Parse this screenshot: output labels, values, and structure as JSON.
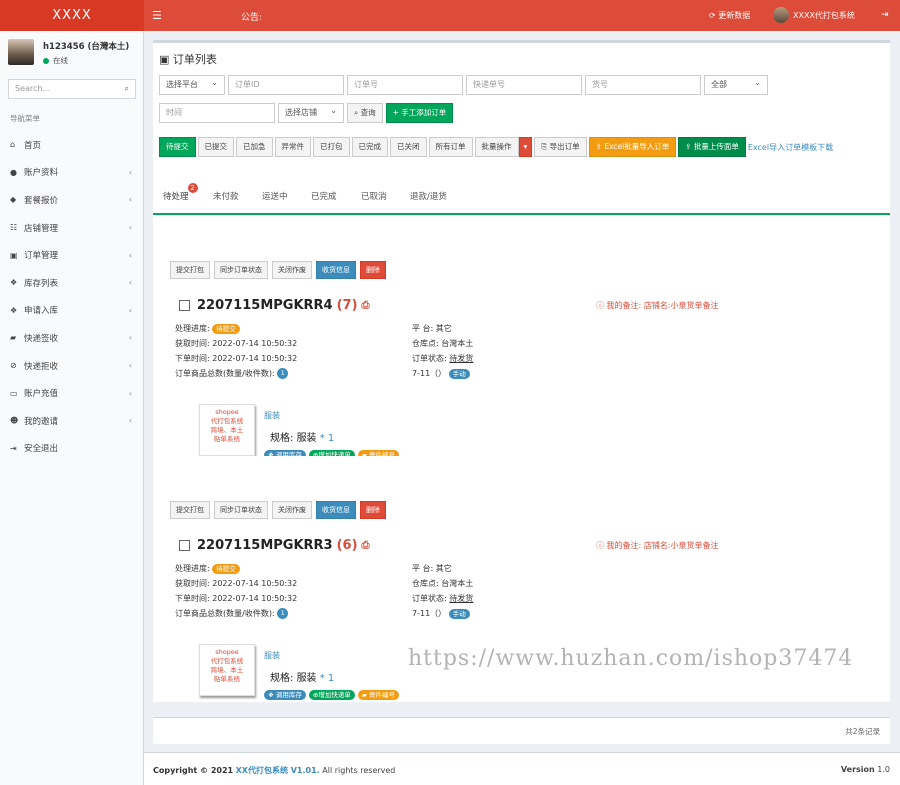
{
  "header": {
    "logo": "XXXX",
    "menu_icon": "bars-icon",
    "notice_label": "公告:",
    "refresh_label": "更新数据",
    "user_label": "XXXX代打包系统"
  },
  "sidebar": {
    "username": "h123456 (台灣本土)",
    "status": "在线",
    "search_placeholder": "Search...",
    "nav_header": "导航菜单",
    "items": [
      {
        "icon": "home-icon",
        "label": "首页",
        "arrow": ""
      },
      {
        "icon": "user-icon",
        "label": "账户资料",
        "arrow": "‹"
      },
      {
        "icon": "tag-icon",
        "label": "套餐报价",
        "arrow": "‹"
      },
      {
        "icon": "list-icon",
        "label": "店铺管理",
        "arrow": "‹"
      },
      {
        "icon": "cart-icon",
        "label": "订单管理",
        "arrow": "‹"
      },
      {
        "icon": "cubes-icon",
        "label": "库存列表",
        "arrow": "‹"
      },
      {
        "icon": "cubes-icon",
        "label": "申请入库",
        "arrow": "‹"
      },
      {
        "icon": "truck-icon",
        "label": "快递签收",
        "arrow": "‹"
      },
      {
        "icon": "ban-icon",
        "label": "快递拒收",
        "arrow": "‹"
      },
      {
        "icon": "credit-card-icon",
        "label": "账户充值",
        "arrow": "‹"
      },
      {
        "icon": "users-icon",
        "label": "我的邀请",
        "arrow": "‹"
      },
      {
        "icon": "sign-out-icon",
        "label": "安全退出",
        "arrow": ""
      }
    ]
  },
  "orders_panel": {
    "title": "订单列表",
    "filters_row1": {
      "platform": "选择平台",
      "order_id": "订单ID",
      "order_no": "订单号",
      "express_no": "快递单号",
      "goods_no": "货号",
      "all": "全部"
    },
    "filters_row2": {
      "time": "时间",
      "shop": "选择店铺",
      "query": "查询",
      "add_manual": "手工添加订单"
    },
    "actions": [
      "待提交",
      "已提交",
      "已加急",
      "异常件",
      "已打包",
      "已完成",
      "已关闭",
      "所有订单",
      "批量操作"
    ],
    "export": "导出订单",
    "excel_import": "Excel批量导入订单",
    "batch_upload": "批量上传面单",
    "template_link": "Excel导入订单模板下载"
  },
  "tabs": [
    {
      "label": "待处理",
      "badge": "2"
    },
    {
      "label": "未付款"
    },
    {
      "label": "运送中"
    },
    {
      "label": "已完成"
    },
    {
      "label": "已取消"
    },
    {
      "label": "退款/退货"
    }
  ],
  "order_buttons": {
    "submit_pack": "提交打包",
    "sync_status": "同步订单状态",
    "close_op": "关闭作废",
    "receiver_info": "收货信息",
    "delete": "删除"
  },
  "order_labels": {
    "progress": "处理进度:",
    "fetch_time": "获取时间:",
    "order_time": "下单时间:",
    "total_goods": "订单商品总数(数量/收件数):",
    "platform": "平 台:",
    "warehouse": "仓库点:",
    "order_status": "订单状态:",
    "manual": "手动",
    "remark_prefix": "我的备注:",
    "shop_prefix": "店铺名:",
    "pill_stock": "调用库存",
    "pill_express": "增加快递单",
    "pill_sender": "寄件编号",
    "spec_prefix": "规格:",
    "thumb_lines": [
      "shopee",
      "代打包系统",
      "跨境、本土",
      "贴单系统"
    ]
  },
  "orders": [
    {
      "number": "2207115MPGKRR4",
      "count": "(7)",
      "progress": "待提交",
      "fetch_time": "2022-07-14 10:50:32",
      "order_time": "2022-07-14 10:50:32",
      "total": "1",
      "platform": "其它",
      "warehouse": "台灣本土",
      "status": "待发货",
      "store": "7-11（）",
      "shop_name": "小泉货单备注",
      "product": "服装",
      "spec": "服装",
      "qty": "* 1"
    },
    {
      "number": "2207115MPGKRR3",
      "count": "(6)",
      "progress": "待提交",
      "fetch_time": "2022-07-14 10:50:32",
      "order_time": "2022-07-14 10:50:32",
      "total": "1",
      "platform": "其它",
      "warehouse": "台灣本土",
      "status": "待发货",
      "store": "7-11（）",
      "shop_name": "小泉货单备注",
      "product": "服装",
      "spec": "服装",
      "qty": "* 1"
    }
  ],
  "pagination": {
    "total_records": "共2条记录"
  },
  "footer": {
    "copyright": "Copyright © 2021",
    "brand": "XX代打包系统 V1.01.",
    "rights": "All rights reserved",
    "version_label": "Version",
    "version": "1.0"
  },
  "watermark": "https://www.huzhan.com/ishop37474",
  "colors": {
    "primary": "#dd4b39",
    "green": "#00a65a",
    "blue": "#3c8dbc",
    "orange": "#f39c12"
  }
}
